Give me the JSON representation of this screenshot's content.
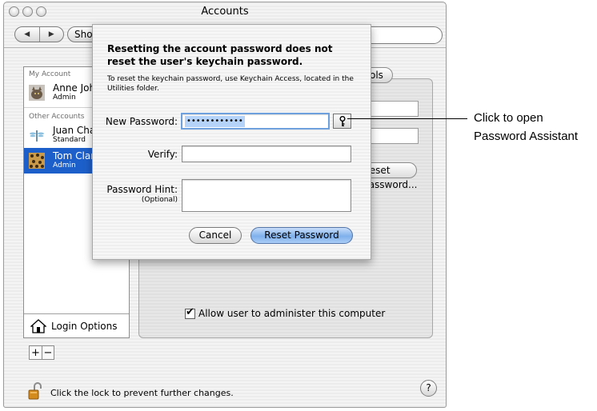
{
  "window": {
    "title": "Accounts",
    "show_all_label": "Show All"
  },
  "sidebar": {
    "my_account_header": "My Account",
    "other_accounts_header": "Other Accounts",
    "accounts": [
      {
        "name": "Anne Johnson",
        "role": "Admin",
        "icon": "cat-photo-icon"
      },
      {
        "name": "Juan Chavez",
        "role": "Standard",
        "icon": "dragonfly-icon"
      },
      {
        "name": "Tom Clark",
        "role": "Admin",
        "icon": "leopard-icon",
        "selected": true
      }
    ],
    "login_options_label": "Login Options"
  },
  "list_controls": {
    "add_label": "+",
    "remove_label": "−"
  },
  "main": {
    "tab_partial_label": "ols",
    "reset_button_label": "Reset Password...",
    "admin_checkbox_label": "Allow user to administer this computer",
    "admin_checked": true
  },
  "footer": {
    "lock_text": "Click the lock to prevent further changes.",
    "help_label": "?"
  },
  "sheet": {
    "message": "Resetting the account password does not reset the user's keychain password.",
    "info": "To reset the keychain password, use Keychain Access, located in the Utilities folder.",
    "new_password_label": "New Password:",
    "new_password_value": "••••••••••••",
    "verify_label": "Verify:",
    "verify_value": "",
    "hint_label": "Password Hint:",
    "hint_optional": "(Optional)",
    "hint_value": "",
    "cancel_label": "Cancel",
    "reset_label": "Reset Password"
  },
  "callout": {
    "line1": "Click to open",
    "line2": "Password Assistant"
  }
}
